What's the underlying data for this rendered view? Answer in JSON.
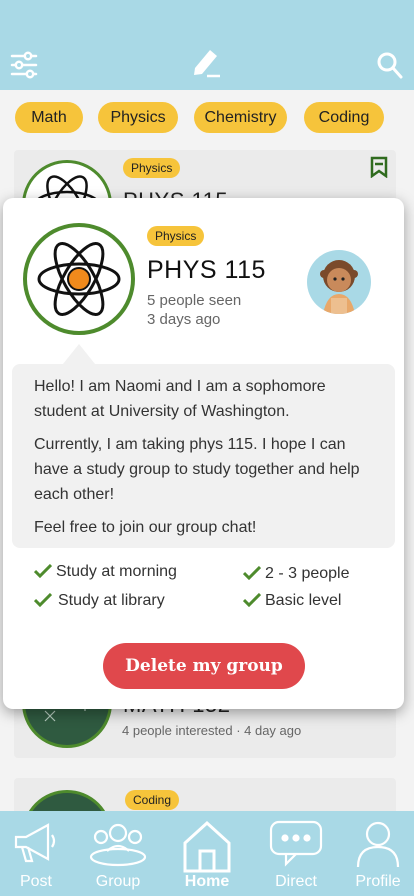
{
  "header": {
    "filter_icon": "sliders-icon",
    "compose_icon": "pencil-icon",
    "search_icon": "search-icon"
  },
  "categories": [
    "Math",
    "Physics",
    "Chemistry",
    "Coding"
  ],
  "feed": [
    {
      "tag": "Physics",
      "title": "PHYS 115"
    },
    {
      "title": "MATH 152",
      "meta": "4 people interested · 4 day ago"
    },
    {
      "tag": "Coding"
    }
  ],
  "detail": {
    "tag": "Physics",
    "title": "PHYS 115",
    "seen": "5 people seen",
    "posted": "3 days ago",
    "message": [
      "Hello! I am Naomi and I am a sophomore student at University of Washington.",
      "Currently, I am taking phys 115. I hope I can have a study group to study together and help each other!",
      "Feel free to join our group chat!"
    ],
    "requirements": [
      "Study at morning",
      "Study at library",
      "2 - 3 people",
      "Basic level"
    ],
    "delete_label": "Delete my group"
  },
  "nav": [
    {
      "label": "Post",
      "icon": "megaphone-icon"
    },
    {
      "label": "Group",
      "icon": "group-icon"
    },
    {
      "label": "Home",
      "icon": "home-icon",
      "active": true
    },
    {
      "label": "Direct",
      "icon": "chat-icon"
    },
    {
      "label": "Profile",
      "icon": "person-icon"
    }
  ],
  "colors": {
    "header_bg": "#a9d9e6",
    "chip": "#f6c43b",
    "accent_green": "#4e8b2d",
    "delete": "#e0484c"
  }
}
